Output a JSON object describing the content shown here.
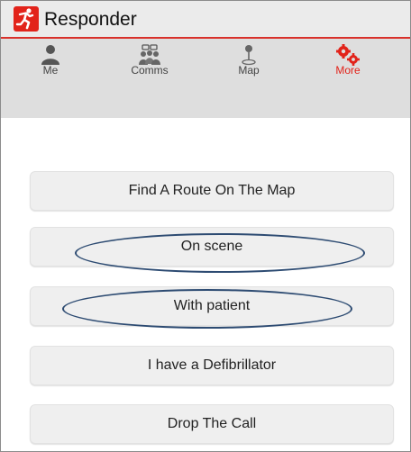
{
  "app": {
    "title": "Responder"
  },
  "tabs": [
    {
      "label": "Me",
      "icon": "person-icon"
    },
    {
      "label": "Comms",
      "icon": "comms-icon"
    },
    {
      "label": "Map",
      "icon": "map-pin-icon"
    },
    {
      "label": "More",
      "icon": "gears-icon",
      "active": true
    }
  ],
  "actions": [
    {
      "label": "Find A Route On The Map"
    },
    {
      "label": "On scene",
      "highlighted": true
    },
    {
      "label": "With patient",
      "highlighted": true
    },
    {
      "label": "I have a Defibrillator"
    },
    {
      "label": "Drop The Call"
    }
  ],
  "colors": {
    "accent": "#e2231a",
    "header_bg": "#ebebeb",
    "tabbar_bg": "#dedede",
    "button_bg": "#efefef",
    "annotation": "#2d4b72"
  }
}
